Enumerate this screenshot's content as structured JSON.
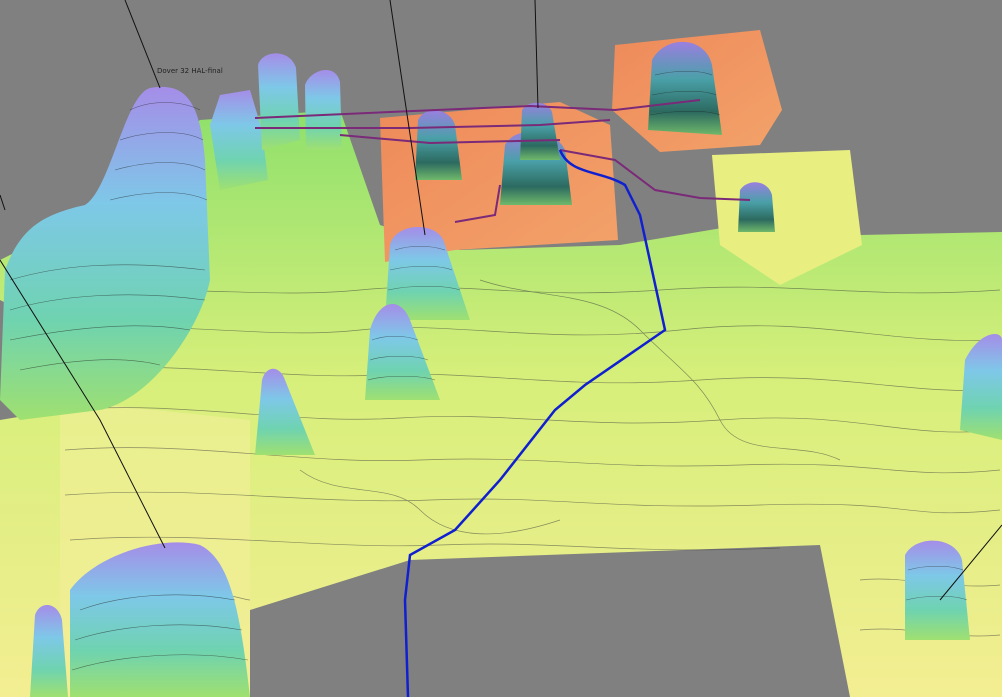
{
  "view": {
    "background_color": "#808080",
    "well_label": "Dover 32 HAL-final",
    "colors": {
      "low": "#f2ef8c",
      "mid": "#9fe870",
      "high": "#7fd7e8",
      "peak": "#9b86e8",
      "hot": "#f0804a",
      "well_path": "#1020d0",
      "pipeline": "#7a2a78",
      "contour": "#3a3a3a"
    }
  }
}
